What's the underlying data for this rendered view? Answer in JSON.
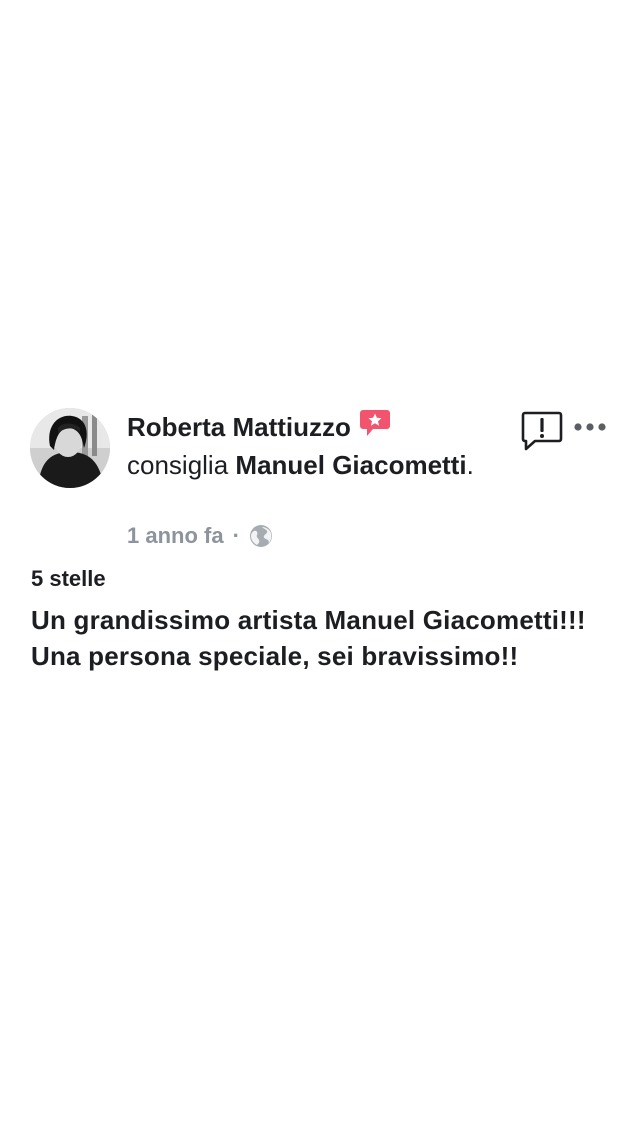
{
  "post": {
    "author": "Roberta Mattiuzzo",
    "recommends_text": "consiglia",
    "page_name": "Manuel Giacometti",
    "period": ".",
    "timestamp": "1 anno fa",
    "separator": "·",
    "privacy_icon": "globe-icon",
    "badge_icon": "recommendation-star-badge-icon",
    "rating": "5 stelle",
    "review": "Un grandissimo artista Manuel Giacometti!!! Una persona speciale, sei bravissimo!!"
  },
  "actions": {
    "report_icon": "report-alert-icon",
    "more_icon": "more-dots-icon"
  },
  "colors": {
    "text": "#1c1e21",
    "meta": "#8d949e",
    "badge": "#f2546e"
  }
}
